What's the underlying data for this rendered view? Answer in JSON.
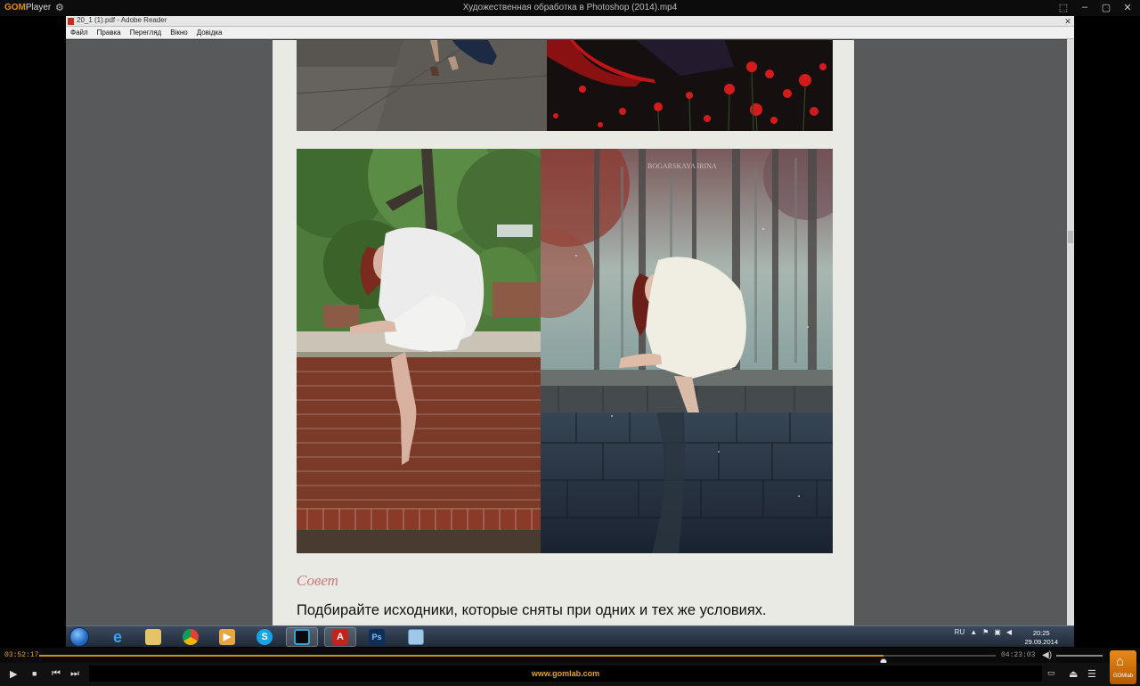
{
  "player": {
    "brand_gom": "GOM",
    "brand_player": "Player",
    "title": "Художественная обработка в Photoshop (2014).mp4",
    "time_current": "03:52:17",
    "time_total": "04:23:03",
    "progress": 0.883,
    "ad_text": "www.gomlab.com",
    "gomlab_label": "GOMlab",
    "accent_color": "#e88a1a"
  },
  "reader": {
    "title": "20_1 (1).pdf - Adobe Reader",
    "menu": [
      "Файл",
      "Правка",
      "Перегляд",
      "Вікно",
      "Довідка"
    ]
  },
  "page": {
    "tip_label": "Совет",
    "tip_text": "Подбирайте исходники, которые сняты при одних и тех же условиях.",
    "watermark": "BOGARSKAYA IRINA"
  },
  "taskbar": {
    "apps": [
      "windows-explorer",
      "internet-explorer",
      "file-explorer",
      "chrome",
      "media-player",
      "skype",
      "monitor-app",
      "adobe-reader",
      "photoshop",
      "image-viewer"
    ],
    "language": "RU",
    "time": "20:25",
    "date": "29.09.2014"
  }
}
